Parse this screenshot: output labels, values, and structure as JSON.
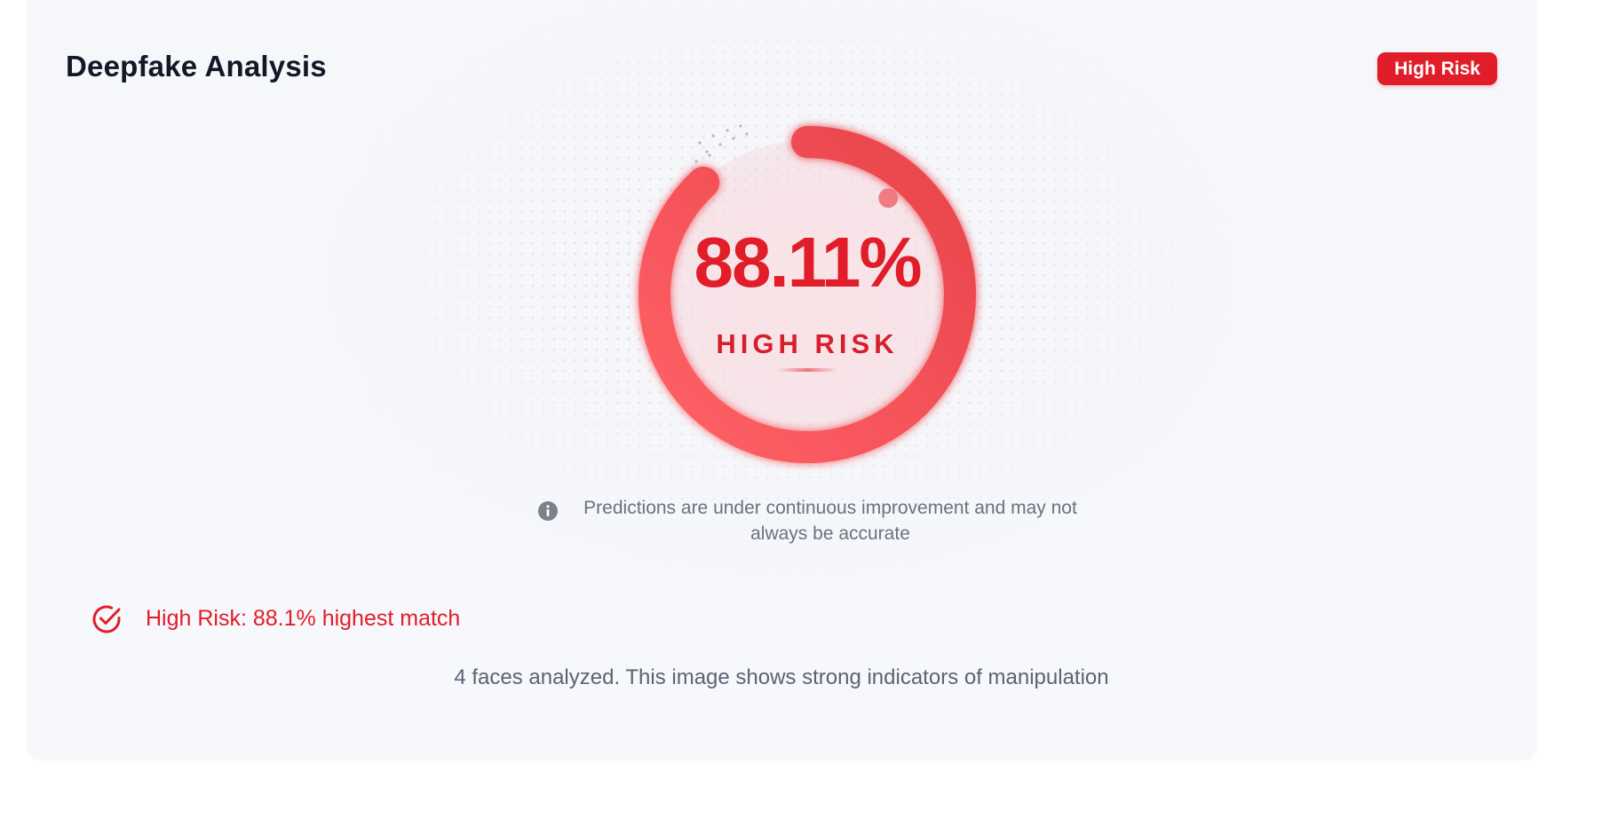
{
  "card": {
    "title": "Deepfake Analysis",
    "badge_label": "High Risk"
  },
  "gauge": {
    "value_text": "88.11%",
    "label": "HIGH RISK",
    "progress": 0.8811,
    "color": "#f05257"
  },
  "disclaimer": {
    "icon": "info-icon",
    "text": "Predictions are under continuous improvement and may not always be accurate"
  },
  "summary": {
    "icon": "check-circle-icon",
    "headline": "High Risk: 88.1% highest match",
    "detail": "4 faces analyzed. This image shows strong indicators of manipulation"
  },
  "colors": {
    "risk_red": "#e11d2a",
    "card_bg": "#f4f6fa",
    "text_dark": "#111827",
    "text_muted": "#6b7280"
  }
}
